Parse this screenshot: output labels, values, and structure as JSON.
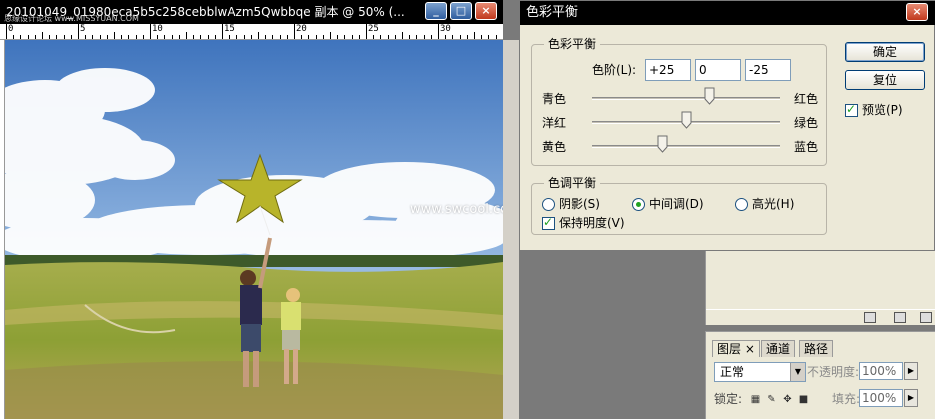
{
  "document": {
    "title": "20101049_01980eca5b5c258cebblwAzm5Qwbbqe 副本 @ 50% (...",
    "small_watermark": "思缘设计论坛 www.MISSYUAN.COM",
    "site_watermark": "www.swcool.com",
    "ruler_numbers": [
      "0",
      "5",
      "10",
      "15",
      "20",
      "25",
      "30"
    ]
  },
  "dialog": {
    "title": "色彩平衡",
    "color_balance_group": {
      "title": "色彩平衡",
      "levels_label": "色阶(L):",
      "levels": [
        "+25",
        "0",
        "-25"
      ],
      "sliders": [
        {
          "left": "青色",
          "right": "红色",
          "value": 25
        },
        {
          "left": "洋红",
          "right": "绿色",
          "value": 0
        },
        {
          "left": "黄色",
          "right": "蓝色",
          "value": -25
        }
      ]
    },
    "tone_balance_group": {
      "title": "色调平衡",
      "shadows": "阴影(S)",
      "midtones": "中间调(D)",
      "highlights": "高光(H)",
      "selected": "midtones",
      "preserve_luminosity": "保持明度(V)",
      "preserve_checked": true
    },
    "ok_label": "确定",
    "reset_label": "复位",
    "preview_label": "预览(P)",
    "preview_checked": true
  },
  "layers_panel": {
    "tabs": [
      "图层",
      "通道",
      "路径"
    ],
    "tab_close": "×",
    "blend_mode": "正常",
    "opacity_label": "不透明度:",
    "opacity_value": "100%",
    "lock_label": "锁定:",
    "fill_label": "填充:",
    "fill_value": "100%"
  },
  "colors": {
    "titlebar": "#000000",
    "dialog_bg": "#ece9d8",
    "checkmark": "#21a121",
    "sky_top": "#4f86c9",
    "grass": "#8da035",
    "kite": "#b8b42a"
  },
  "icons": [
    "close-icon",
    "minimize-icon",
    "maximize-icon",
    "new-layer-icon",
    "trash-icon",
    "lock-icon",
    "brush-icon",
    "move-icon"
  ]
}
